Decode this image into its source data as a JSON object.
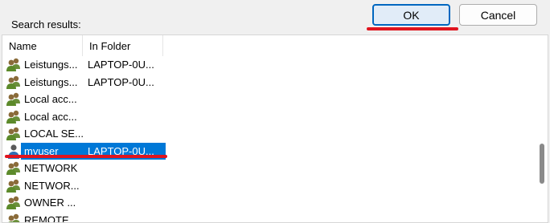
{
  "dialog": {
    "search_results_label": "Search results:",
    "ok_label": "OK",
    "cancel_label": "Cancel"
  },
  "columns": {
    "name": "Name",
    "in_folder": "In Folder"
  },
  "rows": [
    {
      "name": "Leistungs...",
      "folder": "LAPTOP-0U...",
      "icon": "group-icon"
    },
    {
      "name": "Leistungs...",
      "folder": "LAPTOP-0U...",
      "icon": "group-icon"
    },
    {
      "name": "Local acc...",
      "folder": "",
      "icon": "group-icon"
    },
    {
      "name": "Local acc...",
      "folder": "",
      "icon": "group-icon"
    },
    {
      "name": "LOCAL SE...",
      "folder": "",
      "icon": "group-icon"
    },
    {
      "name": "myuser",
      "folder": "LAPTOP-0U...",
      "icon": "user-icon",
      "selected": true
    },
    {
      "name": "NETWORK",
      "folder": "",
      "icon": "group-icon"
    },
    {
      "name": "NETWOR...",
      "folder": "",
      "icon": "group-icon"
    },
    {
      "name": "OWNER ...",
      "folder": "",
      "icon": "group-icon"
    },
    {
      "name": "REMOTE ...",
      "folder": "",
      "icon": "group-icon"
    }
  ],
  "colors": {
    "selection": "#0078d7",
    "annotation_red": "#e0141e"
  }
}
